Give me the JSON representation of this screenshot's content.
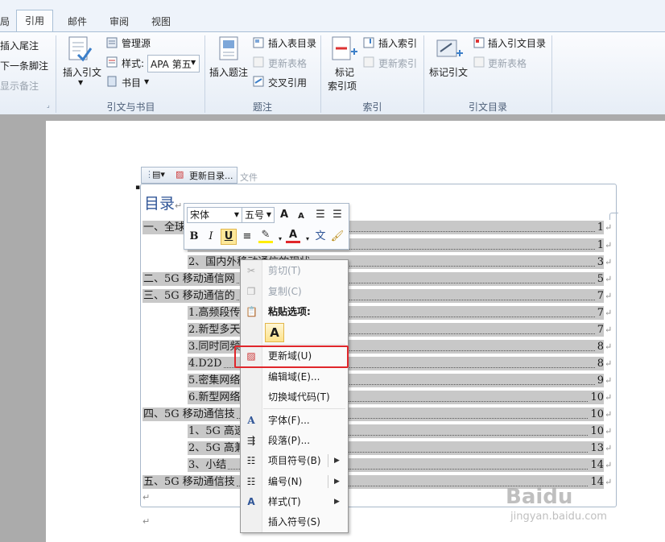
{
  "tabs": [
    {
      "label": "局"
    },
    {
      "label": "引用"
    },
    {
      "label": "邮件"
    },
    {
      "label": "审阅"
    },
    {
      "label": "视图"
    }
  ],
  "ribbon": {
    "footnotes": {
      "insert_endnote": "插入尾注",
      "next_footnote": "下一条脚注",
      "show_notes": "显示备注"
    },
    "citations": {
      "insert_citation": "插入引文",
      "manage_sources": "管理源",
      "style_label": "样式:",
      "style_value": "APA 第五",
      "bibliography": "书目",
      "group_label": "引文与书目"
    },
    "captions": {
      "insert_caption": "插入题注",
      "insert_table_of_figures": "插入表目录",
      "update_table": "更新表格",
      "cross_reference": "交叉引用",
      "group_label": "题注"
    },
    "index": {
      "mark_entry_1": "标记",
      "mark_entry_2": "索引项",
      "insert_index": "插入索引",
      "update_index": "更新索引",
      "group_label": "索引"
    },
    "toa": {
      "mark_citation": "标记引文",
      "insert_toa": "插入引文目录",
      "update_table": "更新表格",
      "group_label": "引文目录"
    }
  },
  "toc_toolbar": {
    "update_label": "更新目录...",
    "ghost_text": "文件"
  },
  "document": {
    "title": "目录",
    "para_mark": "↵",
    "bottom_mark": "↵",
    "rows": [
      {
        "text": "一、全球",
        "num": "1"
      },
      {
        "text": "1、全球移动通信技术的发展历程",
        "num": "1"
      },
      {
        "text": "2、国内外移动通信的现状",
        "num": "3"
      },
      {
        "text": "二、5G 移动通信网",
        "num": "5"
      },
      {
        "text": "三、5G 移动通信的",
        "num": "7"
      },
      {
        "text": "1.高频段传",
        "num": "7"
      },
      {
        "text": "2.新型多天",
        "num": "7"
      },
      {
        "text": "3.同时同频",
        "num": "8"
      },
      {
        "text": "4.D2D",
        "num": "8"
      },
      {
        "text": "5.密集网络",
        "num": "9"
      },
      {
        "text": "6.新型网络",
        "num": "10"
      },
      {
        "text": "四、5G 移动通信技",
        "num": "10"
      },
      {
        "text": "1、5G 高速",
        "num": "10"
      },
      {
        "text": "2、5G 高兼",
        "num": "13"
      },
      {
        "text": "3、小结",
        "num": "14"
      },
      {
        "text": "五、5G 移动通信技",
        "num": "14"
      }
    ]
  },
  "mini_toolbar": {
    "font_name": "宋体",
    "font_size": "五号",
    "grow": "A",
    "shrink": "A",
    "bold": "B",
    "italic": "I",
    "underline": "U",
    "font_color_letter": "A",
    "phonetic": "文"
  },
  "context_menu": {
    "items": [
      {
        "label": "剪切(T)",
        "state": "disabled"
      },
      {
        "label": "复制(C)",
        "state": "disabled"
      },
      {
        "label": "粘贴选项:",
        "state": "header"
      },
      {
        "label": "更新域(U)",
        "state": "highlighted"
      },
      {
        "label": "编辑域(E)...",
        "state": "normal"
      },
      {
        "label": "切换域代码(T)",
        "state": "normal"
      },
      {
        "label": "字体(F)...",
        "state": "normal"
      },
      {
        "label": "段落(P)...",
        "state": "normal"
      },
      {
        "label": "项目符号(B)",
        "state": "submenu"
      },
      {
        "label": "编号(N)",
        "state": "submenu"
      },
      {
        "label": "样式(T)",
        "state": "submenu"
      },
      {
        "label": "插入符号(S)",
        "state": "normal"
      }
    ],
    "paste_letter": "A"
  },
  "watermark": {
    "brand": "Baidu",
    "sub": "jingyan.baidu.com"
  },
  "colors": {
    "highlight_red": "#e0262b",
    "toc_title": "#2f5597",
    "selection_gray": "#c8c8c8"
  }
}
